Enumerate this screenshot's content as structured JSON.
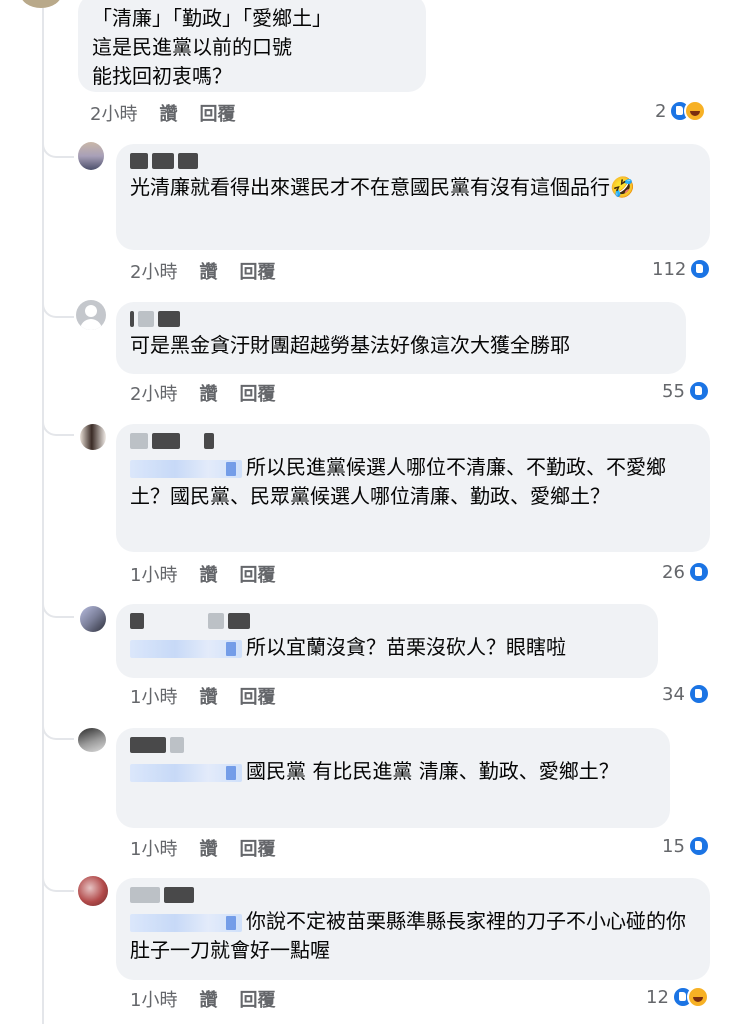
{
  "comments": [
    {
      "text": "「清廉」「勤政」「愛鄉土」\n這是民進黨以前的口號\n能找回初衷嗎？",
      "time": "2小時",
      "like_label": "讚",
      "reply_label": "回覆",
      "reaction_count": "2",
      "reactions": [
        "like-icon",
        "haha-icon"
      ]
    },
    {
      "text": "光清廉就看得出來選民才不在意國民黨有沒有這個品行🤣",
      "time": "2小時",
      "like_label": "讚",
      "reply_label": "回覆",
      "reaction_count": "112",
      "reactions": [
        "like-icon"
      ]
    },
    {
      "text": "可是黑金貪汙財團超越勞基法好像這次大獲全勝耶",
      "time": "2小時",
      "like_label": "讚",
      "reply_label": "回覆",
      "reaction_count": "55",
      "reactions": [
        "like-icon"
      ]
    },
    {
      "text": "所以民進黨候選人哪位不清廉、不勤政、不愛鄉土？國民黨、民眾黨候選人哪位清廉、勤政、愛鄉土？",
      "time": "1小時",
      "like_label": "讚",
      "reply_label": "回覆",
      "reaction_count": "26",
      "reactions": [
        "like-icon"
      ]
    },
    {
      "text": "所以宜蘭沒貪？苗栗沒砍人？眼瞎啦",
      "time": "1小時",
      "like_label": "讚",
      "reply_label": "回覆",
      "reaction_count": "34",
      "reactions": [
        "like-icon"
      ]
    },
    {
      "text": "國民黨 有比民進黨 清廉、勤政、愛鄉土？",
      "time": "1小時",
      "like_label": "讚",
      "reply_label": "回覆",
      "reaction_count": "15",
      "reactions": [
        "like-icon"
      ]
    },
    {
      "text": "你說不定被苗栗縣準縣長家裡的刀子不小心碰的你肚子一刀就會好一點喔",
      "time": "1小時",
      "like_label": "讚",
      "reply_label": "回覆",
      "reaction_count": "12",
      "reactions": [
        "like-icon",
        "haha-icon"
      ]
    }
  ],
  "colors": {
    "bubble": "#f0f2f5",
    "meta": "#65676b",
    "like": "#1b74e4",
    "haha": "#f7b125"
  }
}
